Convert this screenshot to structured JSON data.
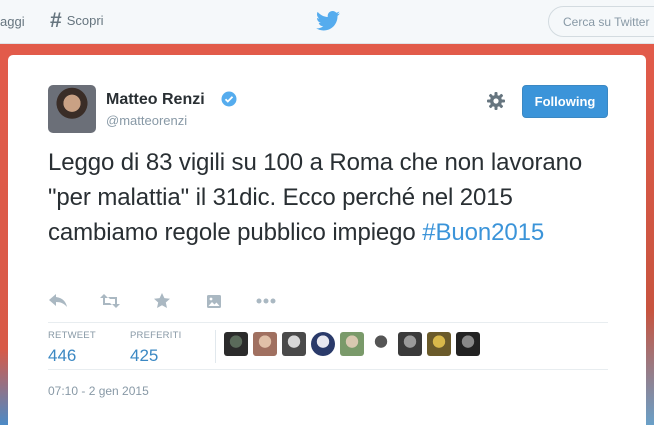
{
  "topbar": {
    "messages_label": "aggi",
    "discover_label": "Scopri",
    "search_placeholder": "Cerca su Twitter"
  },
  "tweet": {
    "author_name": "Matteo Renzi",
    "author_handle": "@matteorenzi",
    "follow_label": "Following",
    "text": "Leggo di 83 vigili su 100 a Roma che non lavorano \"per malattia\" il 31dic. Ecco perché nel 2015 cambiamo regole pubblico impiego ",
    "hashtag": "#Buon2015",
    "retweets_label": "RETWEET",
    "retweets_count": "446",
    "favorites_label": "PREFERITI",
    "favorites_count": "425",
    "timestamp": "07:10 - 2 gen 2015"
  },
  "colors": {
    "accent": "#3b94d9",
    "brand_bird": "#55acee",
    "backdrop": "#e25b4a"
  },
  "icons": [
    "hashtag-icon",
    "twitter-bird-icon",
    "verified-icon",
    "gear-icon",
    "reply-icon",
    "retweet-icon",
    "favorite-icon",
    "photo-icon",
    "more-icon"
  ],
  "favoriters": [
    {
      "color": "#2b2b2b",
      "accent": "#5a6a5a"
    },
    {
      "color": "#a07060",
      "accent": "#e0c0a8"
    },
    {
      "color": "#4a4a4a",
      "accent": "#d8d8d8"
    },
    {
      "color": "#2a3a6a",
      "accent": "#e8e8f0"
    },
    {
      "color": "#7a9a6a",
      "accent": "#d8c8b0"
    },
    {
      "color": "#ffffff",
      "accent": "#555555"
    },
    {
      "color": "#3a3a3a",
      "accent": "#9a9a9a"
    },
    {
      "color": "#6a5a2a",
      "accent": "#d8b84a"
    },
    {
      "color": "#222222",
      "accent": "#888888"
    }
  ]
}
